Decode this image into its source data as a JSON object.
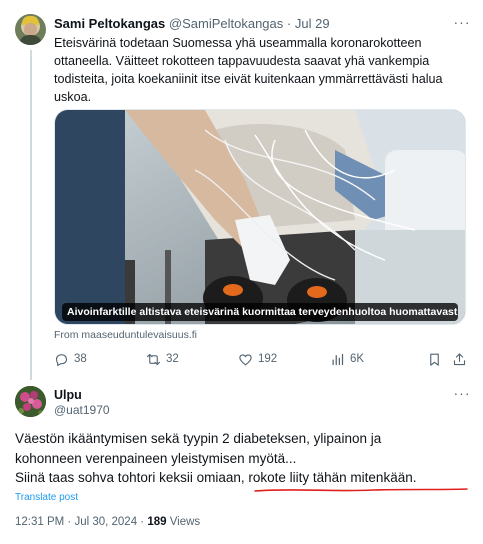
{
  "tweet1": {
    "author_name": "Sami Peltokangas",
    "author_handle": "@SamiPeltokangas",
    "separator": "·",
    "date": "Jul 29",
    "more_label": "···",
    "text_lines": [
      "Eteisvärinä todetaan Suomessa yhä useammalla koronarokotteen",
      "ottaneella. Väitteet rokotteen tappavuudesta saavat yhä vankempia",
      "todisteita, joita koekaniinit itse eivät kuitenkaan ymmärrettävästi halua",
      "uskoa."
    ],
    "media_caption": "Aivoinfarktille altistava eteisvärinä kuormittaa terveydenhuoltoa huomattavasti ...",
    "source": "From maaseuduntulevaisuus.fi",
    "actions": {
      "replies": "38",
      "reposts": "32",
      "likes": "192",
      "views": "6K"
    }
  },
  "tweet2": {
    "author_name": "Ulpu",
    "author_handle": "@uat1970",
    "more_label": "···",
    "text_line1": "Väestön ikääntymisen sekä tyypin 2 diabeteksen, ylipainon ja",
    "text_line2": "kohonneen verenpaineen yleistymisen myötä...",
    "text_line3_part1": "Siinä taas sohva tohtori keksii omiaan, ",
    "text_line3_part2": "rokote liity tähän mitenkään.",
    "translate": "Translate post",
    "time": "12:31 PM · Jul 30, 2024 · ",
    "views_count": "189",
    "views_label": " Views"
  },
  "colors": {
    "text": "#0f1419",
    "secondary": "#536471",
    "link": "#1d9bf0",
    "annotation_red": "#e0201c"
  }
}
